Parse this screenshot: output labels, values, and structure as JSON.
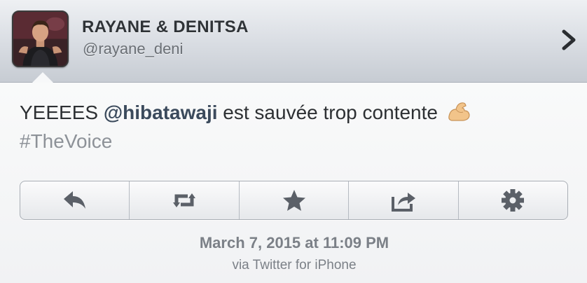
{
  "profile": {
    "display_name": "RAYANE & DENITSA",
    "handle": "@rayane_deni"
  },
  "tweet": {
    "text_before": "YEEEES ",
    "mention": "@hibatawaji",
    "text_after": " est sauvée trop contente ",
    "emoji": "flexed-biceps",
    "hashtag": "#TheVoice"
  },
  "toolbar": {
    "buttons": [
      {
        "action": "reply",
        "icon": "reply-icon"
      },
      {
        "action": "retweet",
        "icon": "retweet-icon"
      },
      {
        "action": "favorite",
        "icon": "star-icon"
      },
      {
        "action": "share",
        "icon": "share-icon"
      },
      {
        "action": "settings",
        "icon": "gear-icon"
      }
    ]
  },
  "meta": {
    "timestamp": "March 7, 2015 at 11:09 PM",
    "source": "via Twitter for iPhone"
  },
  "colors": {
    "icon": "#5b6068",
    "mention": "#3b4a5c",
    "hashtag": "#8d9298"
  }
}
